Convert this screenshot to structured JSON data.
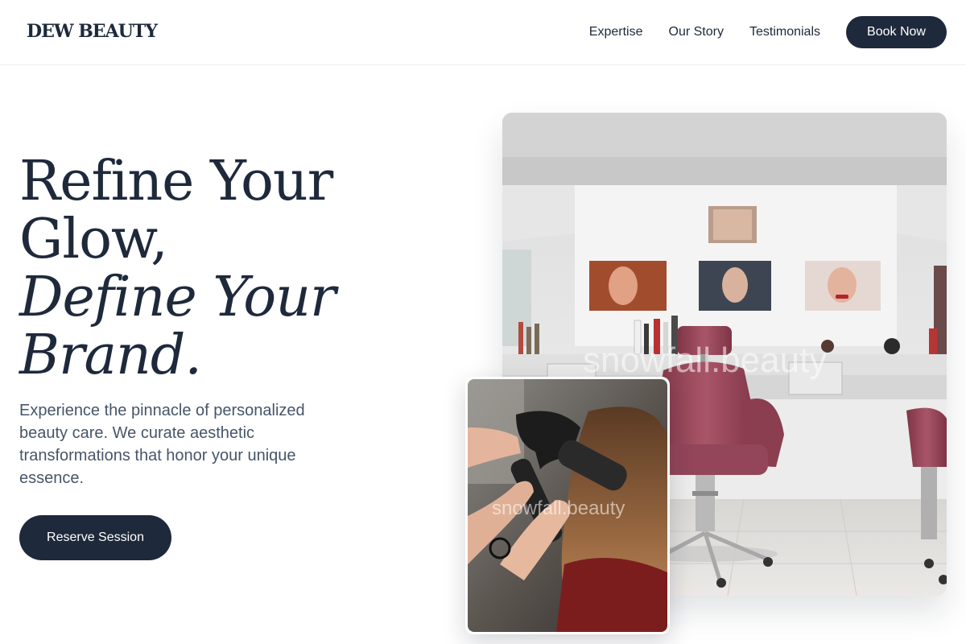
{
  "brand": {
    "logo": "DEW BEAUTY"
  },
  "nav": {
    "links": [
      "Expertise",
      "Our Story",
      "Testimonials"
    ],
    "cta": "Book Now"
  },
  "hero": {
    "title_line1": "Refine Your",
    "title_line2": "Glow,",
    "title_line3": "Define Your",
    "title_line4": "Brand.",
    "description": "Experience the pinnacle of personalized beauty care. We curate aesthetic transformations that honor your unique essence.",
    "cta": "Reserve Session"
  },
  "images": {
    "salon_watermark": "snowfall.beauty",
    "hair_watermark": "snowfall.beauty"
  },
  "colors": {
    "primary": "#1e293b",
    "text_muted": "#475569",
    "chair": "#9b4a5c"
  }
}
